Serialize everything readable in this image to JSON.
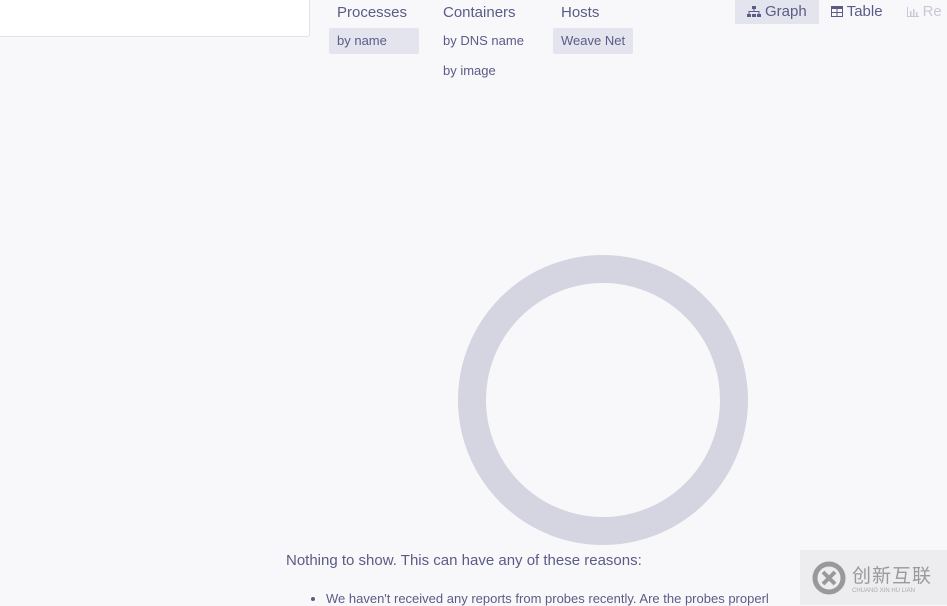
{
  "search": {
    "placeholder": ""
  },
  "topologies": [
    {
      "label": "Processes",
      "subs": [
        {
          "label": "by name",
          "active": true
        }
      ]
    },
    {
      "label": "Containers",
      "subs": [
        {
          "label": "by DNS name",
          "active": false
        },
        {
          "label": "by image",
          "active": false
        }
      ]
    },
    {
      "label": "Hosts",
      "subs": [
        {
          "label": "Weave Net",
          "active": true
        }
      ]
    }
  ],
  "views": [
    {
      "label": "Graph",
      "icon": "sitemap-icon",
      "active": true
    },
    {
      "label": "Table",
      "icon": "table-icon",
      "active": false
    },
    {
      "label": "Re",
      "icon": "chart-icon",
      "disabled": true
    }
  ],
  "empty": {
    "message": "Nothing to show. This can have any of these reasons:",
    "reasons": [
      "We haven't received any reports from probes recently. Are the probes properl"
    ]
  },
  "watermark": {
    "text": "创新互联",
    "subtext": "CHUANG XIN HU LIAN"
  },
  "colors": {
    "accent": "#5b5b88",
    "active_bg": "#e4e4ee",
    "loader": "#d5d4e1"
  }
}
